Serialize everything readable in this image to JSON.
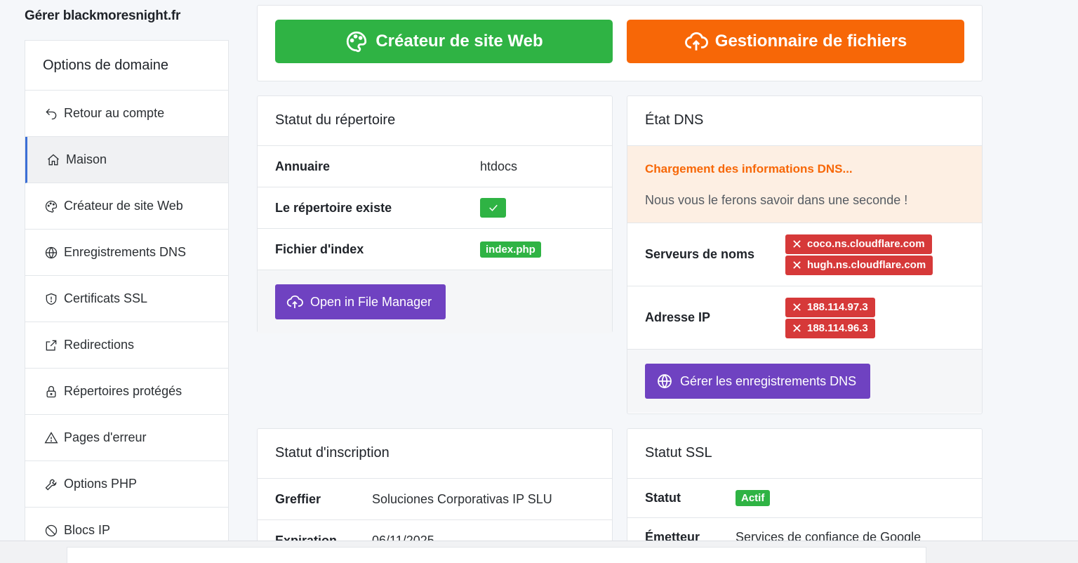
{
  "page_title": "Gérer blackmoresnight.fr",
  "sidebar": {
    "title": "Options de domaine",
    "items": [
      {
        "label": "Retour au compte",
        "icon": "back-arrow-icon"
      },
      {
        "label": "Maison",
        "icon": "home-icon",
        "active": true
      },
      {
        "label": "Créateur de site Web",
        "icon": "palette-icon"
      },
      {
        "label": "Enregistrements DNS",
        "icon": "globe-icon"
      },
      {
        "label": "Certificats SSL",
        "icon": "shield-icon"
      },
      {
        "label": "Redirections",
        "icon": "external-link-icon"
      },
      {
        "label": "Répertoires protégés",
        "icon": "lock-icon"
      },
      {
        "label": "Pages d'erreur",
        "icon": "warning-icon"
      },
      {
        "label": "Options PHP",
        "icon": "wrench-icon"
      },
      {
        "label": "Blocs IP",
        "icon": "block-icon"
      }
    ]
  },
  "actions": {
    "site_builder": "Créateur de site Web",
    "file_manager": "Gestionnaire de fichiers"
  },
  "directory": {
    "title": "Statut du répertoire",
    "rows": {
      "directory_label": "Annuaire",
      "directory_value": "htdocs",
      "exists_label": "Le répertoire existe",
      "index_label": "Fichier d'index",
      "index_value": "index.php"
    },
    "button": "Open in File Manager"
  },
  "dns": {
    "title": "État DNS",
    "alert_title": "Chargement des informations DNS...",
    "alert_message": "Nous vous le ferons savoir dans une seconde !",
    "nameservers_label": "Serveurs de noms",
    "nameservers": [
      "coco.ns.cloudflare.com",
      "hugh.ns.cloudflare.com"
    ],
    "ip_label": "Adresse IP",
    "ips": [
      "188.114.97.3",
      "188.114.96.3"
    ],
    "button": "Gérer les enregistrements DNS"
  },
  "registration": {
    "title": "Statut d'inscription",
    "registrar_label": "Greffier",
    "registrar_value": "Soluciones Corporativas IP SLU",
    "expiration_label": "Expiration",
    "expiration_value": "06/11/2025"
  },
  "ssl": {
    "title": "Statut SSL",
    "status_label": "Statut",
    "status_value": "Actif",
    "issuer_label": "Émetteur",
    "issuer_value": "Services de confiance de Google"
  },
  "colors": {
    "green": "#2fb344",
    "orange": "#f76707",
    "purple": "#6f42c1",
    "red": "#d63939",
    "active_border": "#3b6fd6"
  }
}
